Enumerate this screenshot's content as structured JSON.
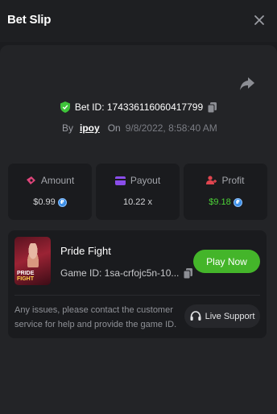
{
  "header": {
    "title": "Bet Slip",
    "close_icon": "close-icon"
  },
  "bet": {
    "id_text": "Bet ID: 174336116060417799",
    "by_label": "By",
    "user": "ipoy",
    "on_label": "On",
    "date": "9/8/2022, 8:58:40 AM"
  },
  "stats": {
    "amount": {
      "label": "Amount",
      "value": "$0.99",
      "icon": "amount-icon"
    },
    "payout": {
      "label": "Payout",
      "value": "10.22 x",
      "icon": "payout-icon"
    },
    "profit": {
      "label": "Profit",
      "value": "$9.18",
      "icon": "profit-icon"
    }
  },
  "game": {
    "name": "Pride Fight",
    "game_id": "Game ID: 1sa-crfojc5n-10...",
    "thumb_title_1": "PRIDE",
    "thumb_title_2": "FIGHT",
    "play_label": "Play Now"
  },
  "support": {
    "notice": "Any issues, please contact the customer service for help and provide the game ID.",
    "button_label": "Live Support"
  },
  "colors": {
    "accent_green": "#44b52a",
    "profit_green": "#4cd137",
    "amount_pink": "#e0457b",
    "payout_purple": "#8a4dea",
    "profit_red": "#e0454f"
  }
}
